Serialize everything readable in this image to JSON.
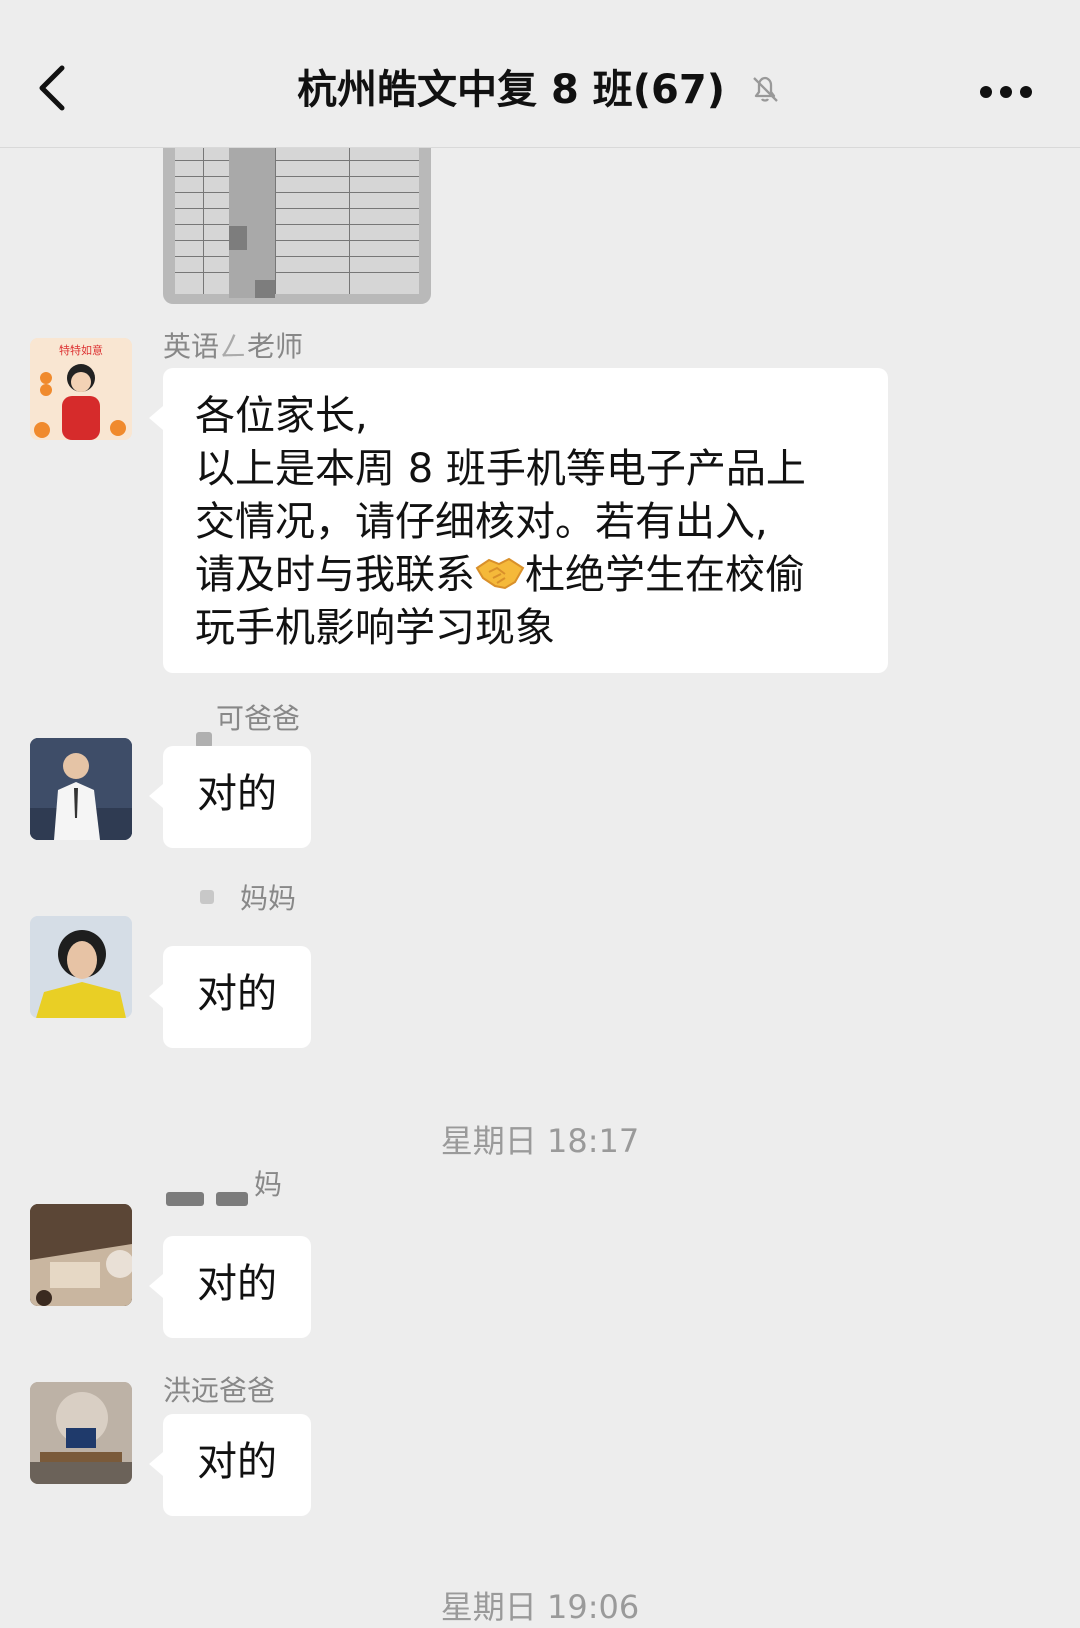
{
  "header": {
    "title": "杭州皓文中复 8 班(67)",
    "back_icon": "chevron-left-icon",
    "mute_icon": "bell-off-icon",
    "more_icon": "more-horizontal-icon"
  },
  "messages": [
    {
      "sender": "英语",
      "sender_suffix": "老师",
      "lines": [
        "各位家长,",
        "以上是本周 8 班手机等电子产品上",
        "交情况，请仔细核对。若有出入,",
        "请及时与我联系",
        "杜绝学生在校偷",
        "玩手机影响学习现象"
      ],
      "emoji": "handshake-icon",
      "avatar_text": "特特如意"
    },
    {
      "sender": "可爸爸",
      "text": "对的"
    },
    {
      "sender": "妈妈",
      "text": "对的"
    },
    {
      "sender": "妈",
      "text": "对的"
    },
    {
      "sender": "洪远爸爸",
      "text": "对的"
    }
  ],
  "timestamps": [
    "星期日 18:17",
    "星期日 19:06"
  ],
  "colors": {
    "background": "#ededed",
    "bubble": "#ffffff",
    "name": "#888888"
  }
}
